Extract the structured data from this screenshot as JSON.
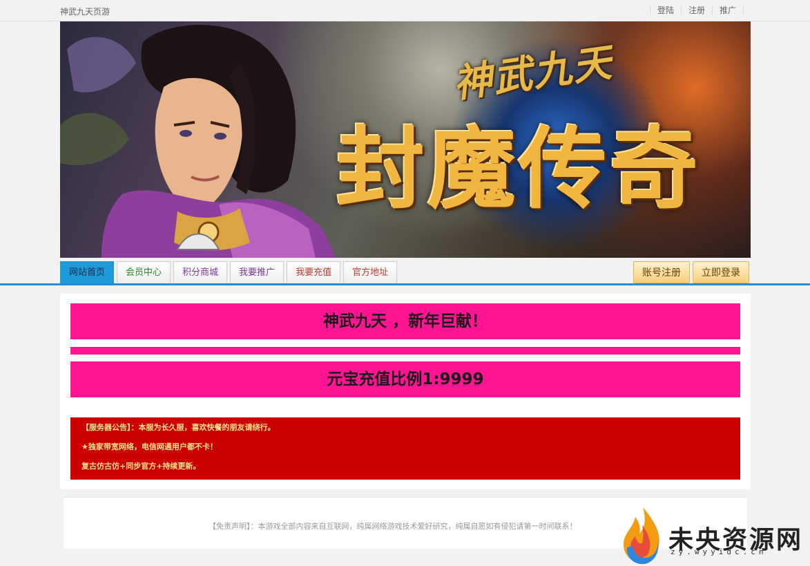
{
  "header": {
    "site_name": "神武九天页游",
    "links": [
      "登陆",
      "注册",
      "推广"
    ]
  },
  "banner": {
    "logo_small": "神武九天",
    "logo_big": "封魔传奇"
  },
  "nav": {
    "tabs": [
      {
        "label": "网站首页",
        "color": "#0b2e4a"
      },
      {
        "label": "会员中心",
        "color": "#2a8a2a"
      },
      {
        "label": "积分商城",
        "color": "#7a3aa0"
      },
      {
        "label": "我要推广",
        "color": "#7a3aa0"
      },
      {
        "label": "我要充值",
        "color": "#c0392b"
      },
      {
        "label": "官方地址",
        "color": "#c0392b"
      }
    ],
    "register_label": "账号注册",
    "login_label": "立即登录"
  },
  "content": {
    "promo_1": "神武九天 ，新年巨献！",
    "promo_2": "元宝充值比例1:9999",
    "notice_lines": [
      "【服务器公告】：本服为长久服，喜欢快餐的朋友请绕行。",
      "★独家带宽网络，电信网通用户都不卡！",
      "复古仿古仿+同步官方+持续更新。"
    ]
  },
  "footer": {
    "disclaimer": "【免责声明】：本游戏全部内容来自互联网，纯属网络游戏技术爱好研究，纯属自愿如有侵犯请第一时间联系！"
  },
  "watermark": {
    "title": "未央资源网",
    "url": "zy.wyyidc.cn"
  },
  "colors": {
    "accent": "#2a8ad0",
    "promo_bg": "#ff1493",
    "notice_bg": "#cc0000",
    "notice_text": "#ffe28a"
  }
}
